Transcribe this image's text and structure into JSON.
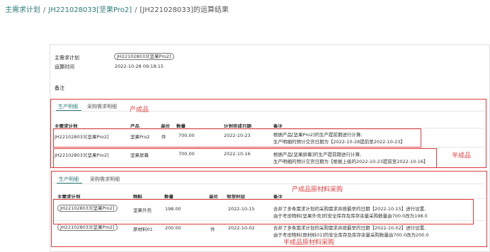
{
  "breadcrumb": {
    "root": "主需求计划",
    "plan": "JH221028033[坚果Pro2]",
    "current": "[JH221028033]的运算结果"
  },
  "info": {
    "plan_label": "主需求计划",
    "plan_value": "JH221028033[坚果Pro2]",
    "time_label": "运算时间",
    "time_value": "2022-10-28 09:18:15",
    "note_label": "备注"
  },
  "top_tabs": {
    "tab1": "生产明细",
    "tab2": "采购需求明细"
  },
  "prod_headers": {
    "plan": "主需求计划",
    "product": "产品",
    "unit": "单位",
    "qty": "数量",
    "date": "计划完成日期",
    "note": "备注"
  },
  "prod_rows": [
    {
      "plan": "JH221028033[坚果Pro2]",
      "product": "坚果Pro2",
      "unit": "件",
      "qty": "700.00",
      "date": "2022-10-23",
      "note1": "根据产品[坚果Pro2]的生产提前期进行计算,",
      "note2": "生产明细的预计交货日期为【2022-10-28提前至2022-10-23】"
    },
    {
      "plan": "JH221028033[坚果Pro2]",
      "product": "坚果屏幕",
      "unit": "",
      "qty": "700.00",
      "date": "2022-10-16",
      "note1": "根据产品[坚果屏幕]的生产提前期进行计算,",
      "note2": "生产明细的预计交货日期为【根据上级的2022-10-23提前至2022-10-16】"
    }
  ],
  "bottom_tabs": {
    "tab1": "生产明细",
    "tab2": "采购需求明细"
  },
  "purch_headers": {
    "plan": "主需求计划",
    "material": "物料",
    "qty": "数量",
    "unit": "单位",
    "date": "到货时间",
    "note": "备注"
  },
  "purch_rows": [
    {
      "plan": "JH221028033[坚果Pro2]",
      "material": "坚果外壳",
      "qty": "198.00",
      "unit": "",
      "date": "2022-10-15",
      "note1": "合并了多条需求计划的采购需求并按最早的日期【2022-10-15】进行设置,",
      "note2": "由于考虑物料[坚果外壳]的安全库存及库存余量采购数量由700.0改为198.0"
    },
    {
      "plan": "JH221028033[坚果Pro2]",
      "material": "原材料01",
      "qty": "200.00",
      "unit": "件",
      "date": "2022-10-02",
      "note1": "合并了多条需求计划的采购需求并按最早的日期【2022-10-02】进行设置,",
      "note2": "由于考虑物料[原材料01]的安全库存及库存余量采购数量由700.0改为200.0"
    }
  ],
  "annotations": {
    "finished": "产成品",
    "semi": "半成品",
    "finished_raw": "产成品原材料采购",
    "semi_raw": "半成品原材料采购"
  },
  "colors": {
    "accent": "#2b7a78",
    "annotation": "#e03a3a"
  }
}
